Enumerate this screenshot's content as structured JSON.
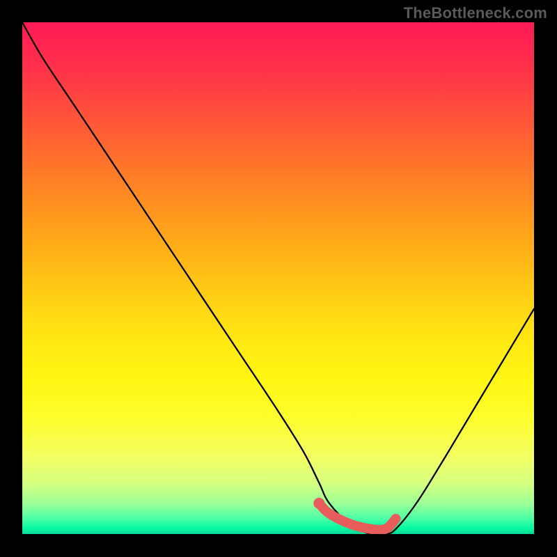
{
  "attribution": "TheBottleneck.com",
  "chart_data": {
    "type": "line",
    "title": "",
    "xlabel": "",
    "ylabel": "",
    "xlim": [
      0,
      100
    ],
    "ylim": [
      0,
      100
    ],
    "grid": false,
    "legend": false,
    "series": [
      {
        "name": "bottleneck-curve",
        "x": [
          0,
          4,
          10,
          18,
          26,
          34,
          42,
          50,
          55,
          58,
          60,
          64,
          68,
          71,
          73,
          77,
          82,
          88,
          94,
          100
        ],
        "y": [
          100,
          93,
          84,
          72,
          60,
          48,
          36,
          24,
          16,
          10,
          6,
          2,
          0,
          0,
          1,
          6,
          14,
          24,
          34,
          44
        ]
      }
    ],
    "highlight_segment": {
      "name": "optimal-range",
      "x": [
        58,
        60,
        64,
        68,
        71,
        73
      ],
      "y": [
        6,
        4,
        2,
        1,
        1,
        3
      ],
      "color": "#e95c5c",
      "width": 14
    },
    "marker": {
      "x": 58,
      "y": 6,
      "color": "#e95c5c",
      "r": 8
    },
    "background_gradient": {
      "top": "#ff1a55",
      "bottom": "#00d99a",
      "note": "red at high values (top) through yellow to green at low values (bottom)"
    }
  }
}
